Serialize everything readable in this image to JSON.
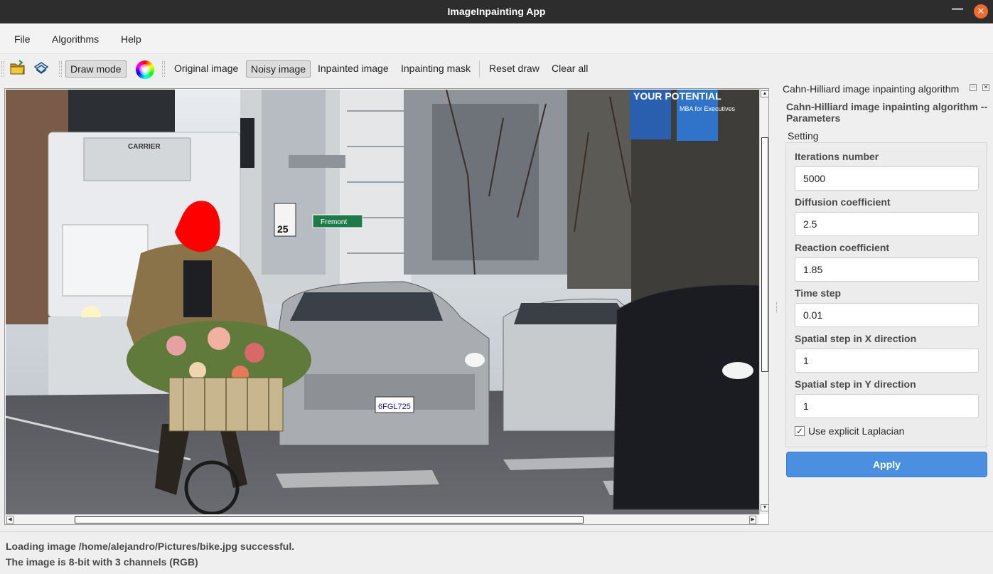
{
  "window": {
    "title": "ImageInpainting App"
  },
  "menu": {
    "items": [
      "File",
      "Algorithms",
      "Help"
    ]
  },
  "toolbar": {
    "draw_mode": "Draw mode",
    "views": [
      "Original image",
      "Noisy image",
      "Inpainted image",
      "Inpainting mask"
    ],
    "active_view": "Noisy image",
    "reset_draw": "Reset draw",
    "clear_all": "Clear all"
  },
  "dock": {
    "title": "Cahn-Hilliard image inpainting algorithm",
    "params_title": "Cahn-Hilliard image inpainting algorithm -- Parameters",
    "group_label": "Setting",
    "fields": [
      {
        "label": "Iterations number",
        "value": "5000"
      },
      {
        "label": "Diffusion coefficient",
        "value": "2.5"
      },
      {
        "label": "Reaction coefficient",
        "value": "1.85"
      },
      {
        "label": "Time step",
        "value": "0.01"
      },
      {
        "label": "Spatial step in X direction",
        "value": "1"
      },
      {
        "label": "Spatial step in Y direction",
        "value": "1"
      }
    ],
    "checkbox": {
      "label": "Use explicit Laplacian",
      "checked": true,
      "mark": "✓"
    },
    "apply": "Apply"
  },
  "image_labels": {
    "truck_brand": "CARRIER",
    "street_sign": "Fremont",
    "speed_limit": "25",
    "plate": "6FGL725",
    "banner_left": "YOUR POTENTIAL",
    "banner_right": "MBA for Executives"
  },
  "status": {
    "line1": "Loading image /home/alejandro/Pictures/bike.jpg successful.",
    "line2": "The image is 8-bit with 3 channels (RGB)"
  },
  "colors": {
    "titlebar": "#2d2d2d",
    "close_button": "#f06a2b",
    "apply_button": "#4a8fe0",
    "mask_red": "#ff0000"
  }
}
